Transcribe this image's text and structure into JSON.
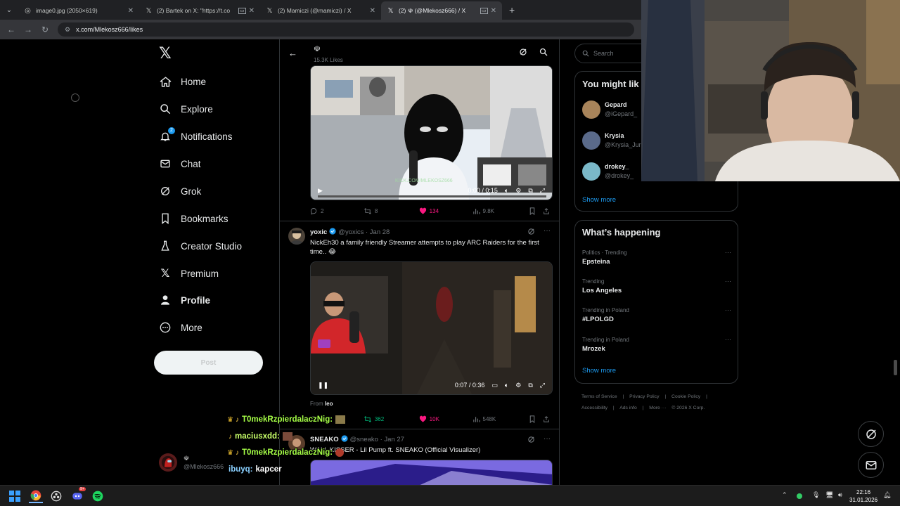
{
  "browser": {
    "tabs": [
      {
        "title": "image0.jpg (2050×619)",
        "icon": "globe-icon",
        "active": false
      },
      {
        "title": "(2) Bartek on X: \"https://t.co",
        "icon": "x-logo-icon",
        "active": false
      },
      {
        "title": "(2) Mamiczi (@mamiczi) / X",
        "icon": "x-logo-icon",
        "active": false
      },
      {
        "title": "(2) ☫ (@Mlekosz666) / X",
        "icon": "x-logo-icon",
        "active": true
      }
    ],
    "url": "x.com/Mlekosz666/likes"
  },
  "nav": {
    "items": [
      {
        "label": "Home",
        "icon": "home-icon"
      },
      {
        "label": "Explore",
        "icon": "search-icon"
      },
      {
        "label": "Notifications",
        "icon": "bell-icon",
        "badge": "2"
      },
      {
        "label": "Chat",
        "icon": "mail-icon"
      },
      {
        "label": "Grok",
        "icon": "grok-icon"
      },
      {
        "label": "Bookmarks",
        "icon": "bookmark-icon"
      },
      {
        "label": "Creator Studio",
        "icon": "flask-icon"
      },
      {
        "label": "Premium",
        "icon": "x-logo-icon"
      },
      {
        "label": "Profile",
        "icon": "person-icon"
      },
      {
        "label": "More",
        "icon": "more-circle-icon"
      }
    ],
    "post_label": "Post",
    "account": {
      "name": "☫",
      "handle": "@Mlekosz666"
    }
  },
  "profile_header": {
    "name": "☫",
    "likes_count": "15.3K Likes"
  },
  "tweets": [
    {
      "video_time": "0:00 / 0:15",
      "video_watermark": "KICK.COM/MLEKOSZ666",
      "replies": "2",
      "reposts": "8",
      "likes": "134",
      "views": "9.8K"
    },
    {
      "name": "yoxic",
      "handle": "@yoxics",
      "date": "Jan 28",
      "text": "NickEh30 a family friendly Streamer attempts to play ARC Raiders for the first time.. 😂",
      "video_time": "0:07 / 0:36",
      "from_label": "From",
      "from_user": "leo",
      "replies": "",
      "reposts": "362",
      "likes": "10K",
      "views": "548K"
    },
    {
      "name": "SNEAKO",
      "handle": "@sneako",
      "date": "Jan 27",
      "text": "WALL KISSER - Lil Pump ft. SNEAKO (Official Visualizer)"
    }
  ],
  "right": {
    "search_placeholder": "Search",
    "who_title": "You might lik",
    "who": [
      {
        "name": "Gepard",
        "handle": "@iGepard_",
        "color": "#a8845a"
      },
      {
        "name": "Krysia",
        "handle": "@Krysia_Jur",
        "color": "#5a6a8a"
      },
      {
        "name": "drokey_",
        "handle": "@drokey_",
        "color": "#7ab8c8"
      }
    ],
    "show_more": "Show more",
    "trends_title": "What’s happening",
    "trends": [
      {
        "context": "Politics · Trending",
        "name": "Epsteina"
      },
      {
        "context": "Trending",
        "name": "Los Angeles"
      },
      {
        "context": "Trending in Poland",
        "name": "#LPOLGD"
      },
      {
        "context": "Trending in Poland",
        "name": "Mrozek"
      }
    ],
    "footer_line1": [
      "Terms of Service",
      "|",
      "Privacy Policy",
      "|",
      "Cookie Policy",
      "|"
    ],
    "footer_line2": [
      "Accessibility",
      "|",
      "Ads info",
      "|",
      "More ···",
      "© 2026 X Corp."
    ]
  },
  "chat": [
    {
      "user": "T0mekRzpierdalaczNig:",
      "message": "",
      "crown": true
    },
    {
      "user": "maciusxdd:",
      "message": "",
      "crown": false
    },
    {
      "user": "T0mekRzpierdalaczNig:",
      "message": "",
      "crown": true
    },
    {
      "user": "ibuyq:",
      "message": "kapcer",
      "crown": false
    }
  ],
  "taskbar": {
    "time": "22:16",
    "date": "31.01.2026",
    "discord_badge": "9+"
  }
}
